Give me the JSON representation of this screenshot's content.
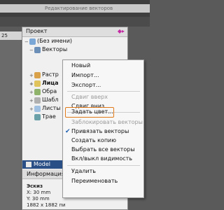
{
  "app": {
    "top_title": "Редактирование векторов",
    "ruler_text": "25"
  },
  "panel": {
    "title": "Проект",
    "tree": [
      {
        "label": "(Без имени)"
      },
      {
        "label": "Векторы"
      },
      {
        "label": "Растр"
      },
      {
        "label": "Лица"
      },
      {
        "label": "Обра"
      },
      {
        "label": "Шабл"
      },
      {
        "label": "Листы"
      },
      {
        "label": "Трае"
      }
    ],
    "model_label": "Model",
    "info_tab": "Информация о",
    "sketch": {
      "title": "Эскиз",
      "x": "X: 30 mm",
      "y": "Y: 30 mm",
      "px": "1882 x 1882 пи"
    }
  },
  "context_menu": {
    "items": [
      {
        "label": "Новый",
        "disabled": false
      },
      {
        "label": "Импорт...",
        "disabled": false
      },
      {
        "label": "Экспорт...",
        "disabled": false
      },
      {
        "label": "Сдвиг вверх",
        "disabled": true
      },
      {
        "label": "Сдвиг вниз",
        "disabled": false
      },
      {
        "label": "Задать цвет...",
        "disabled": false,
        "highlighted": true
      },
      {
        "label": "Заблокировать векторы",
        "disabled": true
      },
      {
        "label": "Привязать векторы",
        "disabled": false,
        "checked": true
      },
      {
        "label": "Создать копию",
        "disabled": false
      },
      {
        "label": "Выбрать все векторы",
        "disabled": false
      },
      {
        "label": "Вкл/выкл видимость",
        "disabled": false
      },
      {
        "label": "Удалить",
        "disabled": false
      },
      {
        "label": "Переименовать",
        "disabled": false
      }
    ]
  },
  "colors": {
    "accent_blue": "#2a4f86",
    "highlight_orange": "#e07a18",
    "tools_magenta": "#c32aa3"
  }
}
